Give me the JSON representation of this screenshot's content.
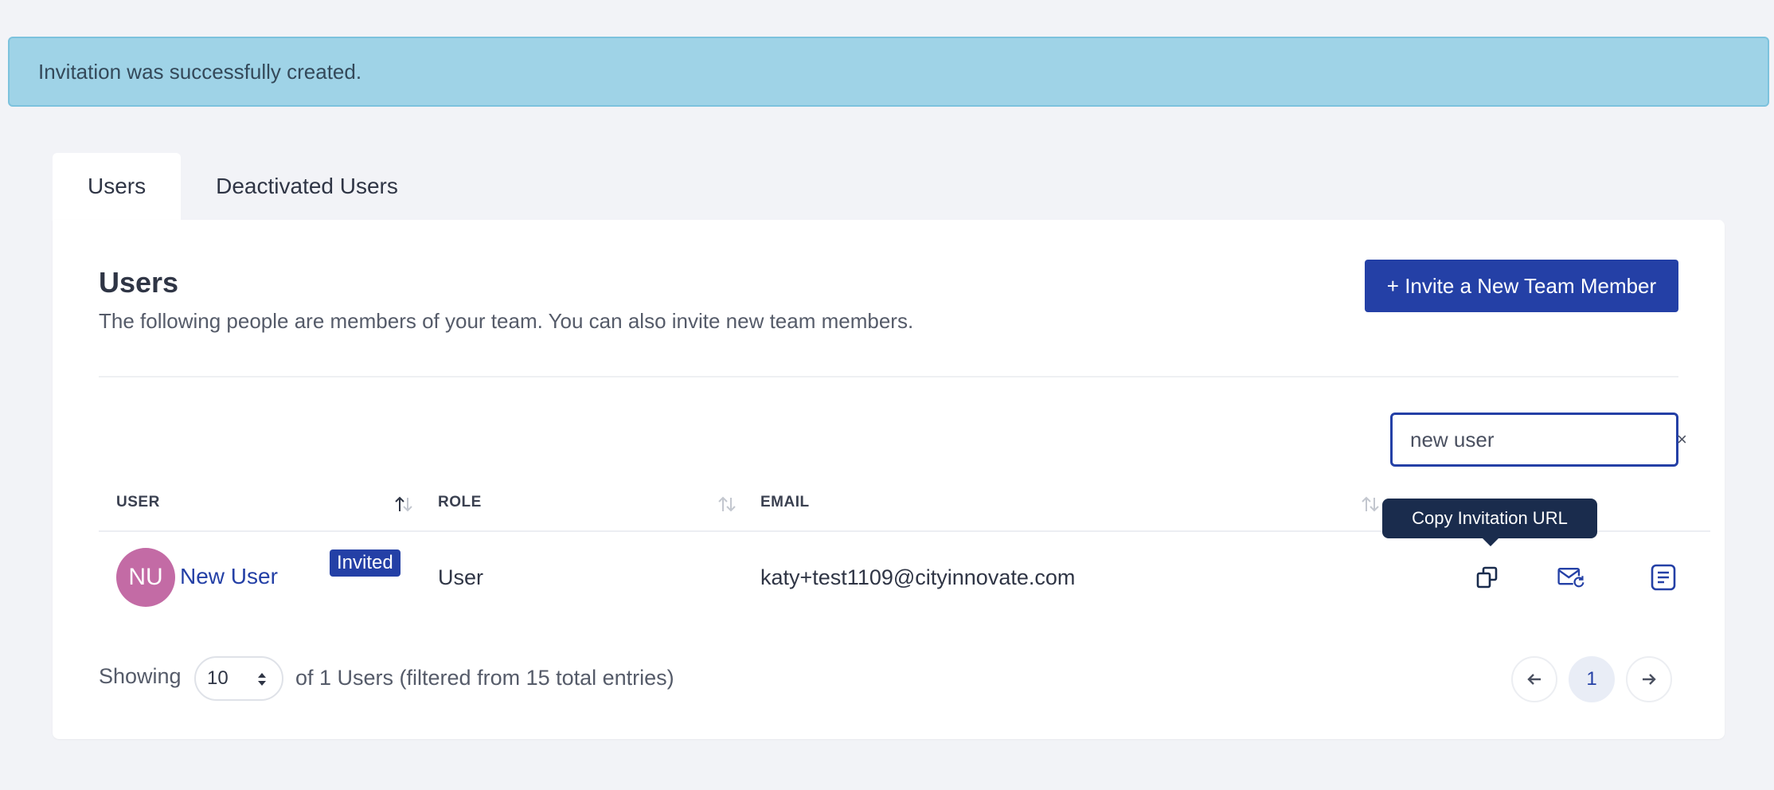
{
  "alert": {
    "message": "Invitation was successfully created."
  },
  "tabs": [
    {
      "label": "Users",
      "active": true
    },
    {
      "label": "Deactivated Users",
      "active": false
    }
  ],
  "card": {
    "title": "Users",
    "subtitle": "The following people are members of your team. You can also invite new team members.",
    "invite_button": "+ Invite a New Team Member"
  },
  "search": {
    "value": "new user",
    "clear_label": "×"
  },
  "table": {
    "columns": [
      {
        "label": "USER",
        "sort": "asc"
      },
      {
        "label": "ROLE",
        "sort": "none"
      },
      {
        "label": "EMAIL",
        "sort": "none"
      }
    ],
    "rows": [
      {
        "initials": "NU",
        "name": "New User",
        "badge": "Invited",
        "role": "User",
        "email": "katy+test1109@cityinnovate.com",
        "actions": [
          "copy-icon",
          "mail-resend-icon",
          "document-icon"
        ]
      }
    ]
  },
  "tooltip": {
    "text": "Copy Invitation URL"
  },
  "footer": {
    "showing_label": "Showing",
    "page_size": "10",
    "summary": "of 1 Users (filtered from 15 total entries)"
  },
  "pagination": {
    "current_page": "1",
    "prev_icon": "arrow-left-icon",
    "next_icon": "arrow-right-icon"
  },
  "colors": {
    "primary": "#2440a6",
    "alert_bg": "#9fd3e7",
    "avatar": "#c36ba5",
    "tooltip_bg": "#1a2c4d",
    "page_bg": "#f2f3f7"
  }
}
